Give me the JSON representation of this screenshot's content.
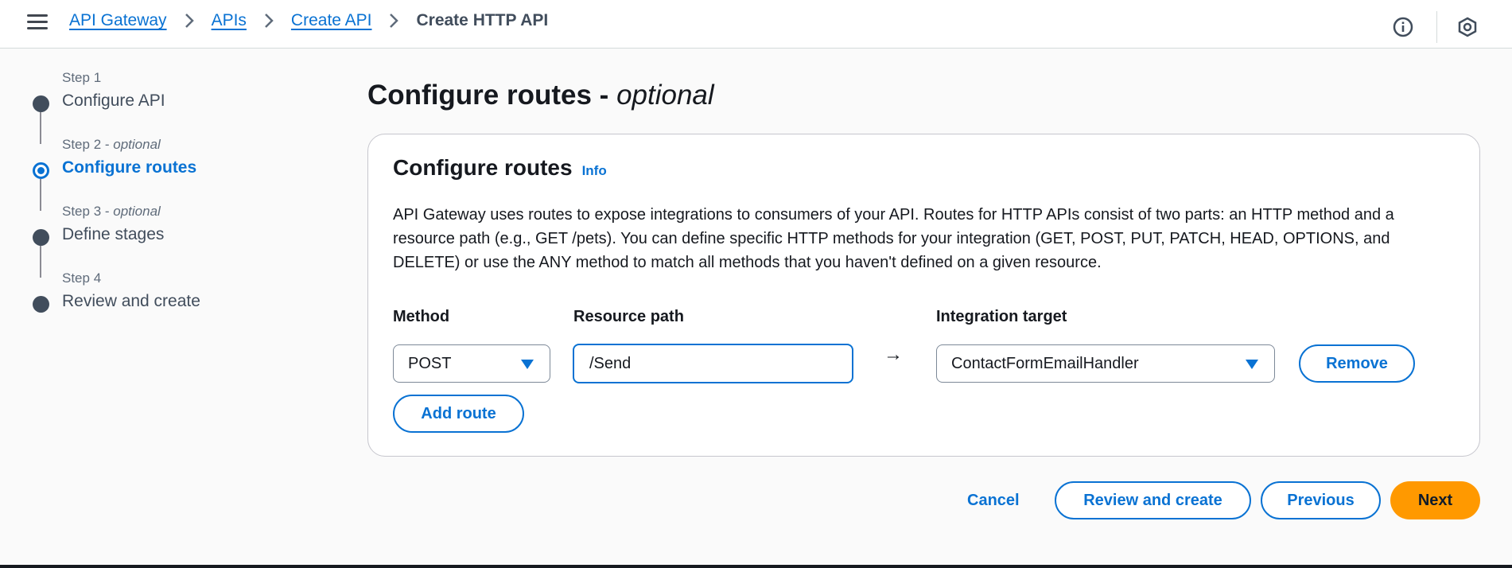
{
  "breadcrumb": {
    "items": [
      "API Gateway",
      "APIs",
      "Create API"
    ],
    "current": "Create HTTP API"
  },
  "icons": {
    "menu": "hamburger-menu-icon",
    "info": "info-circle-icon",
    "settings": "hexagon-gear-icon",
    "separator": "chevron-right-icon"
  },
  "steps": [
    {
      "num": "Step 1",
      "optional": "",
      "title": "Configure API",
      "state": "completed"
    },
    {
      "num": "Step 2 - ",
      "optional": "optional",
      "title": "Configure routes",
      "state": "active"
    },
    {
      "num": "Step 3 - ",
      "optional": "optional",
      "title": "Define stages",
      "state": "pending"
    },
    {
      "num": "Step 4",
      "optional": "",
      "title": "Review and create",
      "state": "pending"
    }
  ],
  "page": {
    "title": "Configure routes - ",
    "title_optional": "optional"
  },
  "panel": {
    "title": "Configure routes",
    "info_link": "Info",
    "description": "API Gateway uses routes to expose integrations to consumers of your API. Routes for HTTP APIs consist of two parts: an HTTP method and a resource path (e.g., GET /pets). You can define specific HTTP methods for your integration (GET, POST, PUT, PATCH, HEAD, OPTIONS, and DELETE) or use the ANY method to match all methods that you haven't defined on a given resource."
  },
  "route": {
    "method_label": "Method",
    "method_value": "POST",
    "path_label": "Resource path",
    "path_value": "/Send",
    "arrow": "→",
    "target_label": "Integration target",
    "target_value": "ContactFormEmailHandler",
    "remove_label": "Remove"
  },
  "add_route_label": "Add route",
  "footer": {
    "cancel": "Cancel",
    "review_create": "Review and create",
    "previous": "Previous",
    "next": "Next"
  },
  "colors": {
    "accent": "#0972d3",
    "primary_button": "#ff9900",
    "text": "#16191f"
  }
}
